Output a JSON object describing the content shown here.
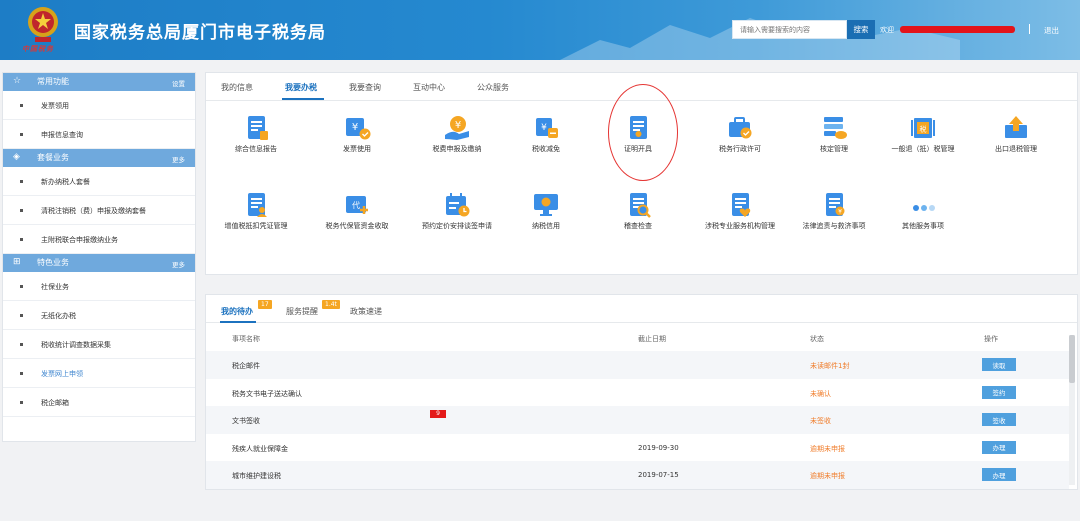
{
  "header": {
    "title": "国家税务总局厦门市电子税务局",
    "emblem_text": "中国税务",
    "search_placeholder": "请输入需要搜索的内容",
    "search_label": "搜索",
    "welcome": "欢迎",
    "logout": "退出"
  },
  "sidebar": {
    "sections": [
      {
        "title": "常用功能",
        "link": "设置",
        "icon": "star-icon",
        "items": [
          "发票领用",
          "申报信息查询"
        ]
      },
      {
        "title": "套餐业务",
        "link": "更多",
        "icon": "stack-icon",
        "items": [
          "新办纳税人套餐",
          "清税注销税（费）申报及缴纳套餐",
          "主附税联合申报缴纳业务"
        ]
      },
      {
        "title": "特色业务",
        "link": "更多",
        "icon": "grid-icon",
        "items": [
          "社保业务",
          "无纸化办税",
          "税收统计调查数据采集",
          "发票网上申领",
          "税企邮箱"
        ]
      }
    ]
  },
  "main": {
    "tabs": [
      "我的信息",
      "我要办税",
      "我要查询",
      "互动中心",
      "公众服务"
    ],
    "services": [
      {
        "label": "综合信息报告",
        "icon": "report-icon"
      },
      {
        "label": "发票使用",
        "icon": "invoice-icon"
      },
      {
        "label": "税费申报及缴纳",
        "icon": "tax-filing-icon"
      },
      {
        "label": "税收减免",
        "icon": "tax-reduction-icon"
      },
      {
        "label": "证明开具",
        "icon": "certificate-icon"
      },
      {
        "label": "税务行政许可",
        "icon": "license-icon"
      },
      {
        "label": "核定管理",
        "icon": "assessment-icon"
      },
      {
        "label": "一般退（抵）税管理",
        "icon": "refund-icon"
      },
      {
        "label": "出口退税管理",
        "icon": "export-refund-icon"
      },
      {
        "label": "增值税抵扣凭证管理",
        "icon": "vat-voucher-icon"
      },
      {
        "label": "税务代保管资金收取",
        "icon": "custody-fund-icon"
      },
      {
        "label": "预约定价安排谈签申请",
        "icon": "pricing-calendar-icon"
      },
      {
        "label": "纳税信用",
        "icon": "credit-icon"
      },
      {
        "label": "稽查检查",
        "icon": "inspection-icon"
      },
      {
        "label": "涉税专业服务机构管理",
        "icon": "agency-icon"
      },
      {
        "label": "法律追责与救济事项",
        "icon": "legal-icon"
      },
      {
        "label": "其他服务事项",
        "icon": "more-dots-icon"
      }
    ]
  },
  "todo": {
    "tabs": [
      {
        "label": "我的待办",
        "badge": "17"
      },
      {
        "label": "服务提醒",
        "badge": "1.4t"
      },
      {
        "label": "政策速递",
        "badge": ""
      }
    ],
    "columns": [
      "事项名称",
      "截止日期",
      "状态",
      "操作"
    ],
    "rows": [
      {
        "name": "税企邮件",
        "date": "",
        "status": "未读邮件1封",
        "action": "读取",
        "badge": ""
      },
      {
        "name": "税务文书电子送达确认",
        "date": "",
        "status": "未确认",
        "action": "签约",
        "badge": ""
      },
      {
        "name": "文书签收",
        "date": "",
        "status": "未签收",
        "action": "签收",
        "badge": "9"
      },
      {
        "name": "残疾人就业保障金",
        "date": "2019-09-30",
        "status": "逾期未申报",
        "action": "办理",
        "badge": ""
      },
      {
        "name": "城市维护建设税",
        "date": "2019-07-15",
        "status": "逾期未申报",
        "action": "办理",
        "badge": ""
      }
    ]
  },
  "colors": {
    "header_blue": "#2589d0",
    "section_blue": "#6fa9dd",
    "accent": "#1c72bf",
    "status_orange": "#f07d2b",
    "button_blue": "#4fa0de",
    "redaction_red": "#e3141a",
    "circle_red": "#e53533"
  }
}
